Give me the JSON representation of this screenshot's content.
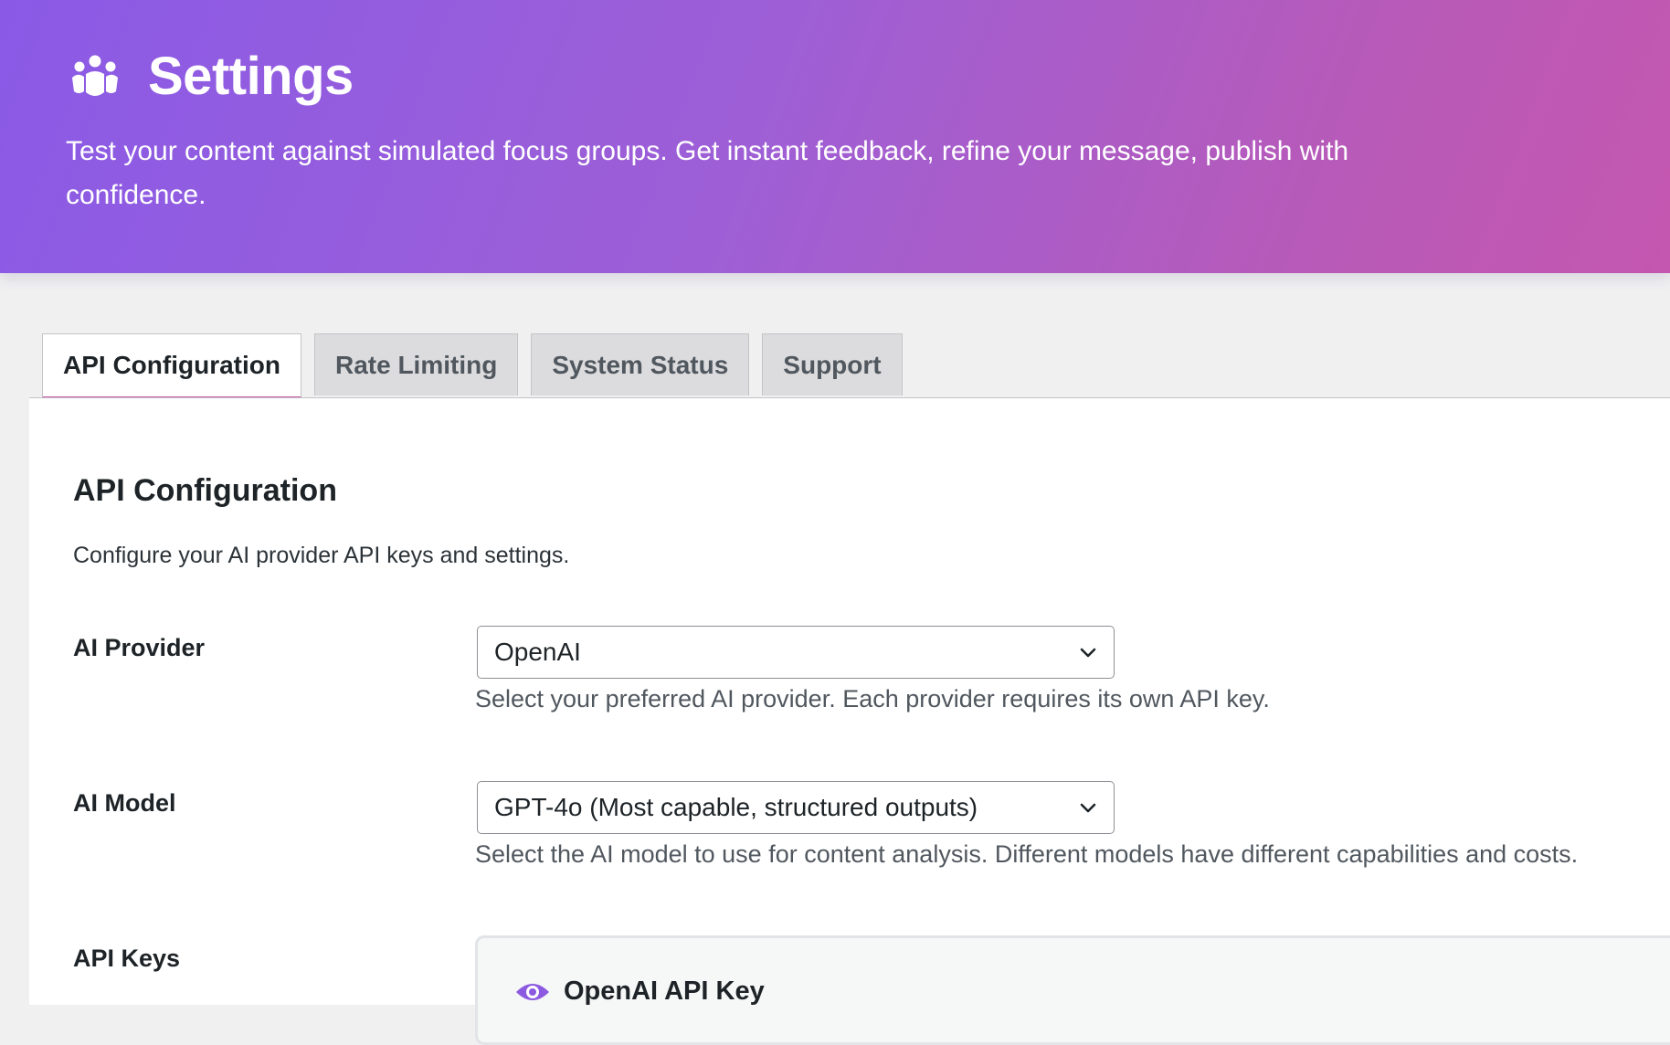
{
  "header": {
    "title": "Settings",
    "icon": "groups-icon",
    "subtitle": "Test your content against simulated focus groups. Get instant feedback, refine your message, publish with confidence."
  },
  "tabs": [
    {
      "label": "API Configuration",
      "active": true
    },
    {
      "label": "Rate Limiting",
      "active": false
    },
    {
      "label": "System Status",
      "active": false
    },
    {
      "label": "Support",
      "active": false
    }
  ],
  "section": {
    "title": "API Configuration",
    "description": "Configure your AI provider API keys and settings."
  },
  "fields": {
    "provider": {
      "label": "AI Provider",
      "value": "OpenAI",
      "help": "Select your preferred AI provider. Each provider requires its own API key."
    },
    "model": {
      "label": "AI Model",
      "value": "GPT-4o (Most capable, structured outputs)",
      "help": "Select the AI model to use for content analysis. Different models have different capabilities and costs."
    },
    "keys": {
      "label": "API Keys",
      "card_title": "OpenAI API Key",
      "card_icon": "eye-icon"
    }
  },
  "colors": {
    "gradient_start": "#8a5ae6",
    "gradient_end": "#c457b0",
    "accent": "#8c5ae0"
  }
}
